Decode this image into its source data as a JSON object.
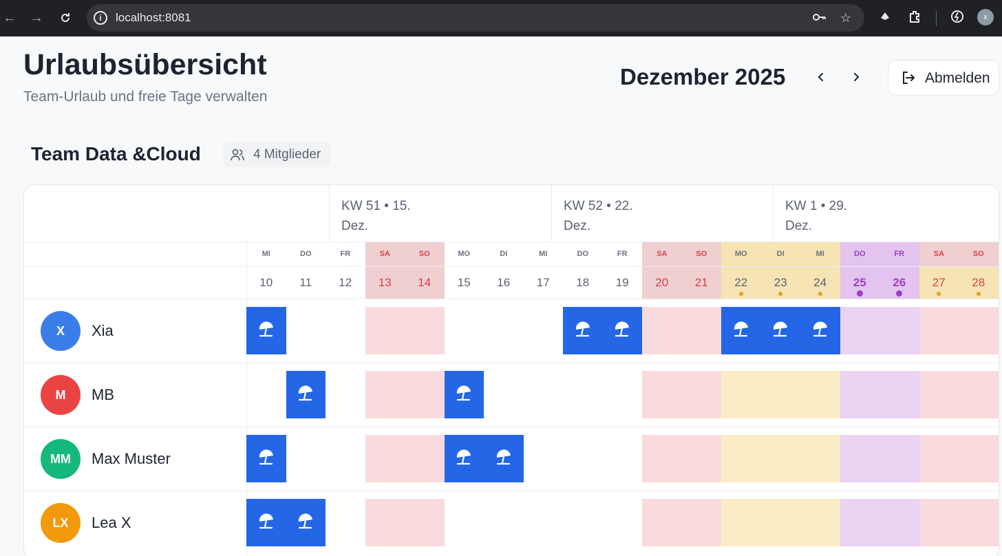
{
  "browser": {
    "url": "localhost:8081",
    "profile_initial": "x"
  },
  "header": {
    "title": "Urlaubsübersicht",
    "subtitle": "Team-Urlaub und freie Tage verwalten",
    "month": "Dezember 2025",
    "prev_icon": "‹",
    "next_icon": "›",
    "logout_label": "Abmelden"
  },
  "team": {
    "name": "Team Data &Cloud",
    "members_label": "4 Mitglieder"
  },
  "weeks": [
    {
      "label": "KW 51 • 15. Dez."
    },
    {
      "label": "KW 52 • 22. Dez."
    },
    {
      "label": "KW 1 • 29. Dez."
    }
  ],
  "days": [
    {
      "abbr": "MI",
      "num": "10",
      "type": "weekday"
    },
    {
      "abbr": "DO",
      "num": "11",
      "type": "weekday"
    },
    {
      "abbr": "FR",
      "num": "12",
      "type": "weekday"
    },
    {
      "abbr": "SA",
      "num": "13",
      "type": "weekend"
    },
    {
      "abbr": "SO",
      "num": "14",
      "type": "weekend"
    },
    {
      "abbr": "MO",
      "num": "15",
      "type": "weekday"
    },
    {
      "abbr": "DI",
      "num": "16",
      "type": "weekday"
    },
    {
      "abbr": "MI",
      "num": "17",
      "type": "weekday"
    },
    {
      "abbr": "DO",
      "num": "18",
      "type": "weekday"
    },
    {
      "abbr": "FR",
      "num": "19",
      "type": "weekday"
    },
    {
      "abbr": "SA",
      "num": "20",
      "type": "weekend"
    },
    {
      "abbr": "SO",
      "num": "21",
      "type": "weekend"
    },
    {
      "abbr": "MO",
      "num": "22",
      "type": "school"
    },
    {
      "abbr": "DI",
      "num": "23",
      "type": "school"
    },
    {
      "abbr": "MI",
      "num": "24",
      "type": "school"
    },
    {
      "abbr": "DO",
      "num": "25",
      "type": "holiday"
    },
    {
      "abbr": "FR",
      "num": "26",
      "type": "holiday"
    },
    {
      "abbr": "SA",
      "num": "27",
      "type": "weekend-school"
    },
    {
      "abbr": "SO",
      "num": "28",
      "type": "weekend-school"
    }
  ],
  "members": [
    {
      "initials": "X",
      "name": "Xia",
      "color": "#3b7de8",
      "vacation_days": [
        0,
        8,
        9,
        12,
        13,
        14
      ]
    },
    {
      "initials": "M",
      "name": "MB",
      "color": "#ea4343",
      "vacation_days": [
        1,
        5
      ]
    },
    {
      "initials": "MM",
      "name": "Max Muster",
      "color": "#14b87a",
      "vacation_days": [
        0,
        5,
        6
      ]
    },
    {
      "initials": "LX",
      "name": "Lea X",
      "color": "#f29a0c",
      "vacation_days": [
        0,
        1
      ]
    }
  ],
  "colors": {
    "vacation": "#2466e6",
    "weekend": "#f9dadd",
    "weekend_header": "#f0cfd1",
    "school_holiday": "#fbecc6",
    "school_holiday_header": "#f6e4b5",
    "public_holiday": "#ead2f3",
    "public_holiday_header": "#e2c4ee"
  },
  "icons": {
    "vacation": "beach-umbrella-icon"
  }
}
